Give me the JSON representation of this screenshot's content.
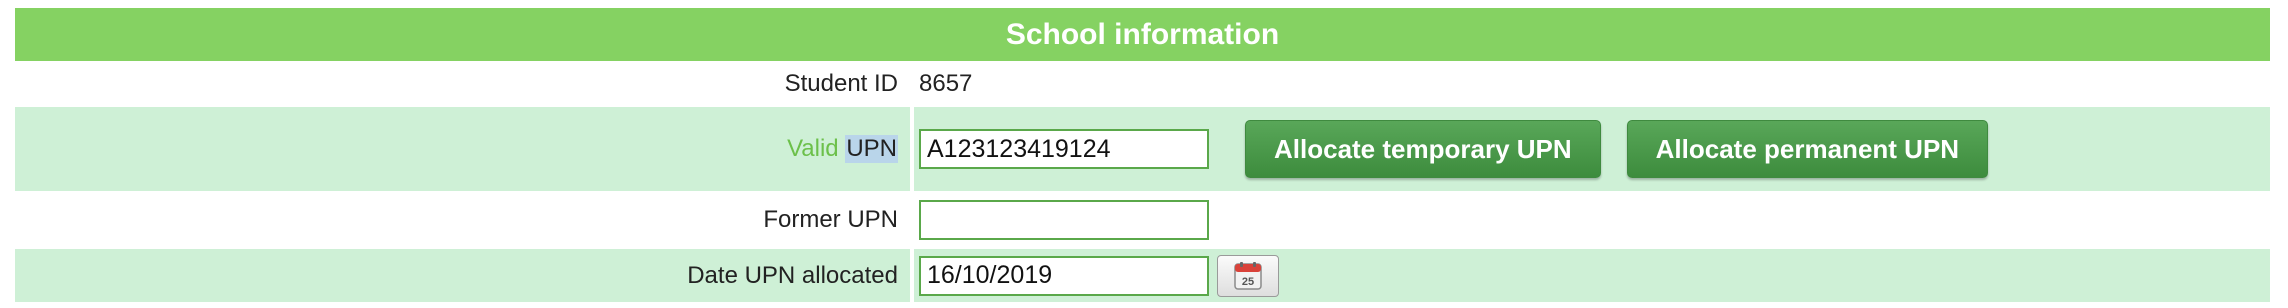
{
  "header": {
    "title": "School information"
  },
  "student_id": {
    "label": "Student ID",
    "value": "8657"
  },
  "upn": {
    "label_valid": "Valid",
    "label_upn": "UPN",
    "value": "A123123419124",
    "allocate_temp_label": "Allocate temporary UPN",
    "allocate_perm_label": "Allocate permanent UPN"
  },
  "former_upn": {
    "label": "Former UPN",
    "value": ""
  },
  "date_upn": {
    "label": "Date UPN allocated",
    "value": "16/10/2019",
    "calendar_day": "25"
  },
  "colors": {
    "header_green": "#85d262",
    "row_green": "#cef0d6",
    "valid_green": "#6cc04a",
    "button_green": "#4a9a4a",
    "highlight_blue": "#b9d5ea"
  }
}
